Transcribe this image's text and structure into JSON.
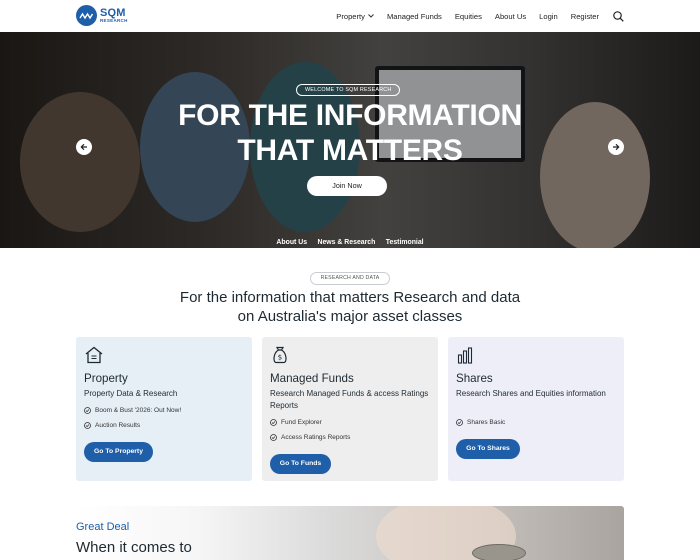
{
  "brand": {
    "name": "SQM",
    "subtitle": "RESEARCH",
    "color": "#1f5ea8"
  },
  "nav": {
    "items": [
      {
        "label": "Property",
        "has_dropdown": true
      },
      {
        "label": "Managed Funds"
      },
      {
        "label": "Equities"
      },
      {
        "label": "About Us"
      },
      {
        "label": "Login"
      },
      {
        "label": "Register"
      }
    ],
    "search_icon": "search-icon"
  },
  "hero": {
    "badge": "WELCOME TO SQM RESEARCH",
    "title_line1": "FOR THE INFORMATION",
    "title_line2": "THAT MATTERS",
    "cta": "Join Now",
    "links": [
      "About Us",
      "News & Research",
      "Testimonial"
    ]
  },
  "section": {
    "badge": "RESEARCH AND DATA",
    "title_line1": "For the information that matters Research and data",
    "title_line2": "on Australia's major asset classes"
  },
  "cards": [
    {
      "icon": "house-icon",
      "title": "Property",
      "desc": "Property Data & Research",
      "bullets": [
        "Boom & Bust '2026: Out Now!",
        "Auction Results"
      ],
      "button": "Go To Property"
    },
    {
      "icon": "money-bag-icon",
      "title": "Managed Funds",
      "desc": "Research Managed Funds & access Ratings Reports",
      "bullets": [
        "Fund Explorer",
        "Access Ratings Reports"
      ],
      "button": "Go To Funds"
    },
    {
      "icon": "bar-chart-icon",
      "title": "Shares",
      "desc": "Research Shares and Equities information",
      "bullets": [
        "Shares Basic"
      ],
      "button": "Go To Shares"
    }
  ],
  "promo": {
    "eyebrow": "Great Deal",
    "heading": "When it comes to"
  }
}
